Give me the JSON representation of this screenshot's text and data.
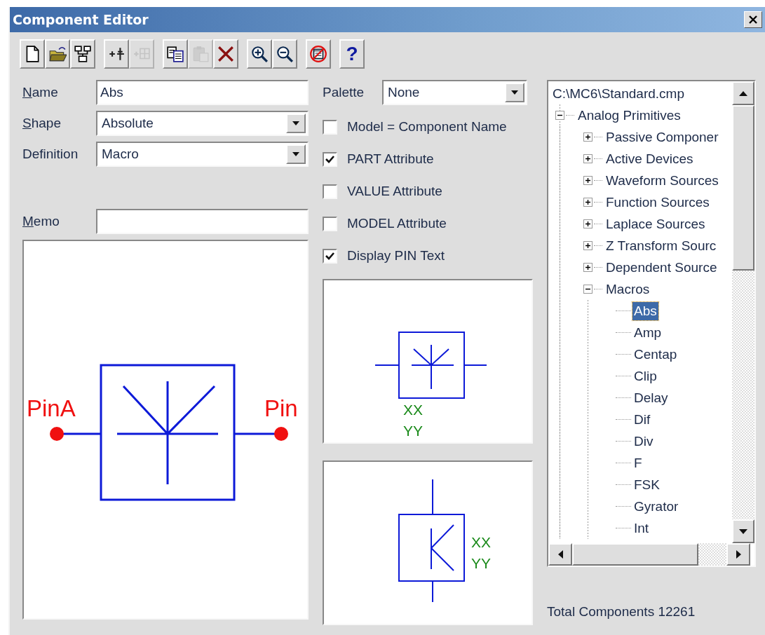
{
  "window": {
    "title": "Component Editor"
  },
  "toolbar": [
    [
      {
        "kind": "new",
        "disabled": false
      },
      {
        "kind": "open",
        "disabled": false
      },
      {
        "kind": "tree",
        "disabled": false
      }
    ],
    [
      {
        "kind": "add-pin",
        "disabled": false
      },
      {
        "kind": "add-grid",
        "disabled": true
      }
    ],
    [
      {
        "kind": "copy",
        "disabled": false
      },
      {
        "kind": "paste",
        "disabled": true
      },
      {
        "kind": "delete",
        "disabled": false
      }
    ],
    [
      {
        "kind": "zoom-in",
        "disabled": false
      },
      {
        "kind": "zoom-out",
        "disabled": false
      }
    ],
    [
      {
        "kind": "no-display",
        "disabled": false
      }
    ],
    [
      {
        "kind": "help",
        "text": "?",
        "disabled": false
      }
    ]
  ],
  "fields": [
    {
      "kind": "text",
      "label": "Name",
      "underlined_initial": true,
      "value": "Abs"
    },
    {
      "kind": "dropdown",
      "label": "Shape",
      "underlined_initial": true,
      "value": "Absolute"
    },
    {
      "kind": "dropdown",
      "label": "Definition",
      "underlined_initial": false,
      "value": "Macro"
    }
  ],
  "memo": {
    "label": "Memo",
    "underlined_initial": true
  },
  "palette": {
    "label": "Palette",
    "value": "None"
  },
  "options": [
    {
      "label": "Model = Component Name",
      "checked": false
    },
    {
      "label": "PART Attribute",
      "checked": true
    },
    {
      "label": "VALUE Attribute",
      "checked": false
    },
    {
      "label": "MODEL Attribute",
      "checked": false
    },
    {
      "label": "Display PIN Text",
      "checked": true
    }
  ],
  "shape_preview": {
    "pin_labels": [
      "PinA",
      "Pin"
    ]
  },
  "small_previews": [
    {
      "kind": "horizontal",
      "labels": [
        "XX",
        "YY"
      ]
    },
    {
      "kind": "vertical",
      "labels": [
        "XX",
        "YY"
      ]
    }
  ],
  "tree": {
    "root": {
      "label": "C:\\MC6\\Standard.cmp",
      "selected": false,
      "children": [
        {
          "label": "Analog Primitives",
          "expanded": true,
          "selected": false,
          "children": [
            {
              "label": "Passive Componer",
              "expanded": false,
              "selected": false
            },
            {
              "label": "Active Devices",
              "expanded": false,
              "selected": false
            },
            {
              "label": "Waveform Sources",
              "expanded": false,
              "selected": false
            },
            {
              "label": "Function Sources",
              "expanded": false,
              "selected": false
            },
            {
              "label": "Laplace Sources",
              "expanded": false,
              "selected": false
            },
            {
              "label": "Z Transform Sourc",
              "expanded": false,
              "selected": false
            },
            {
              "label": "Dependent Source",
              "expanded": false,
              "selected": false
            },
            {
              "label": "Macros",
              "expanded": true,
              "selected": false,
              "children": [
                {
                  "label": "Abs",
                  "selected": true
                },
                {
                  "label": "Amp",
                  "selected": false
                },
                {
                  "label": "Centap",
                  "selected": false
                },
                {
                  "label": "Clip",
                  "selected": false
                },
                {
                  "label": "Delay",
                  "selected": false
                },
                {
                  "label": "Dif",
                  "selected": false
                },
                {
                  "label": "Div",
                  "selected": false
                },
                {
                  "label": "F",
                  "selected": false
                },
                {
                  "label": "FSK",
                  "selected": false
                },
                {
                  "label": "Gyrator",
                  "selected": false
                },
                {
                  "label": "Int",
                  "selected": false
                }
              ]
            }
          ]
        }
      ]
    }
  },
  "total": "Total Components 12261"
}
